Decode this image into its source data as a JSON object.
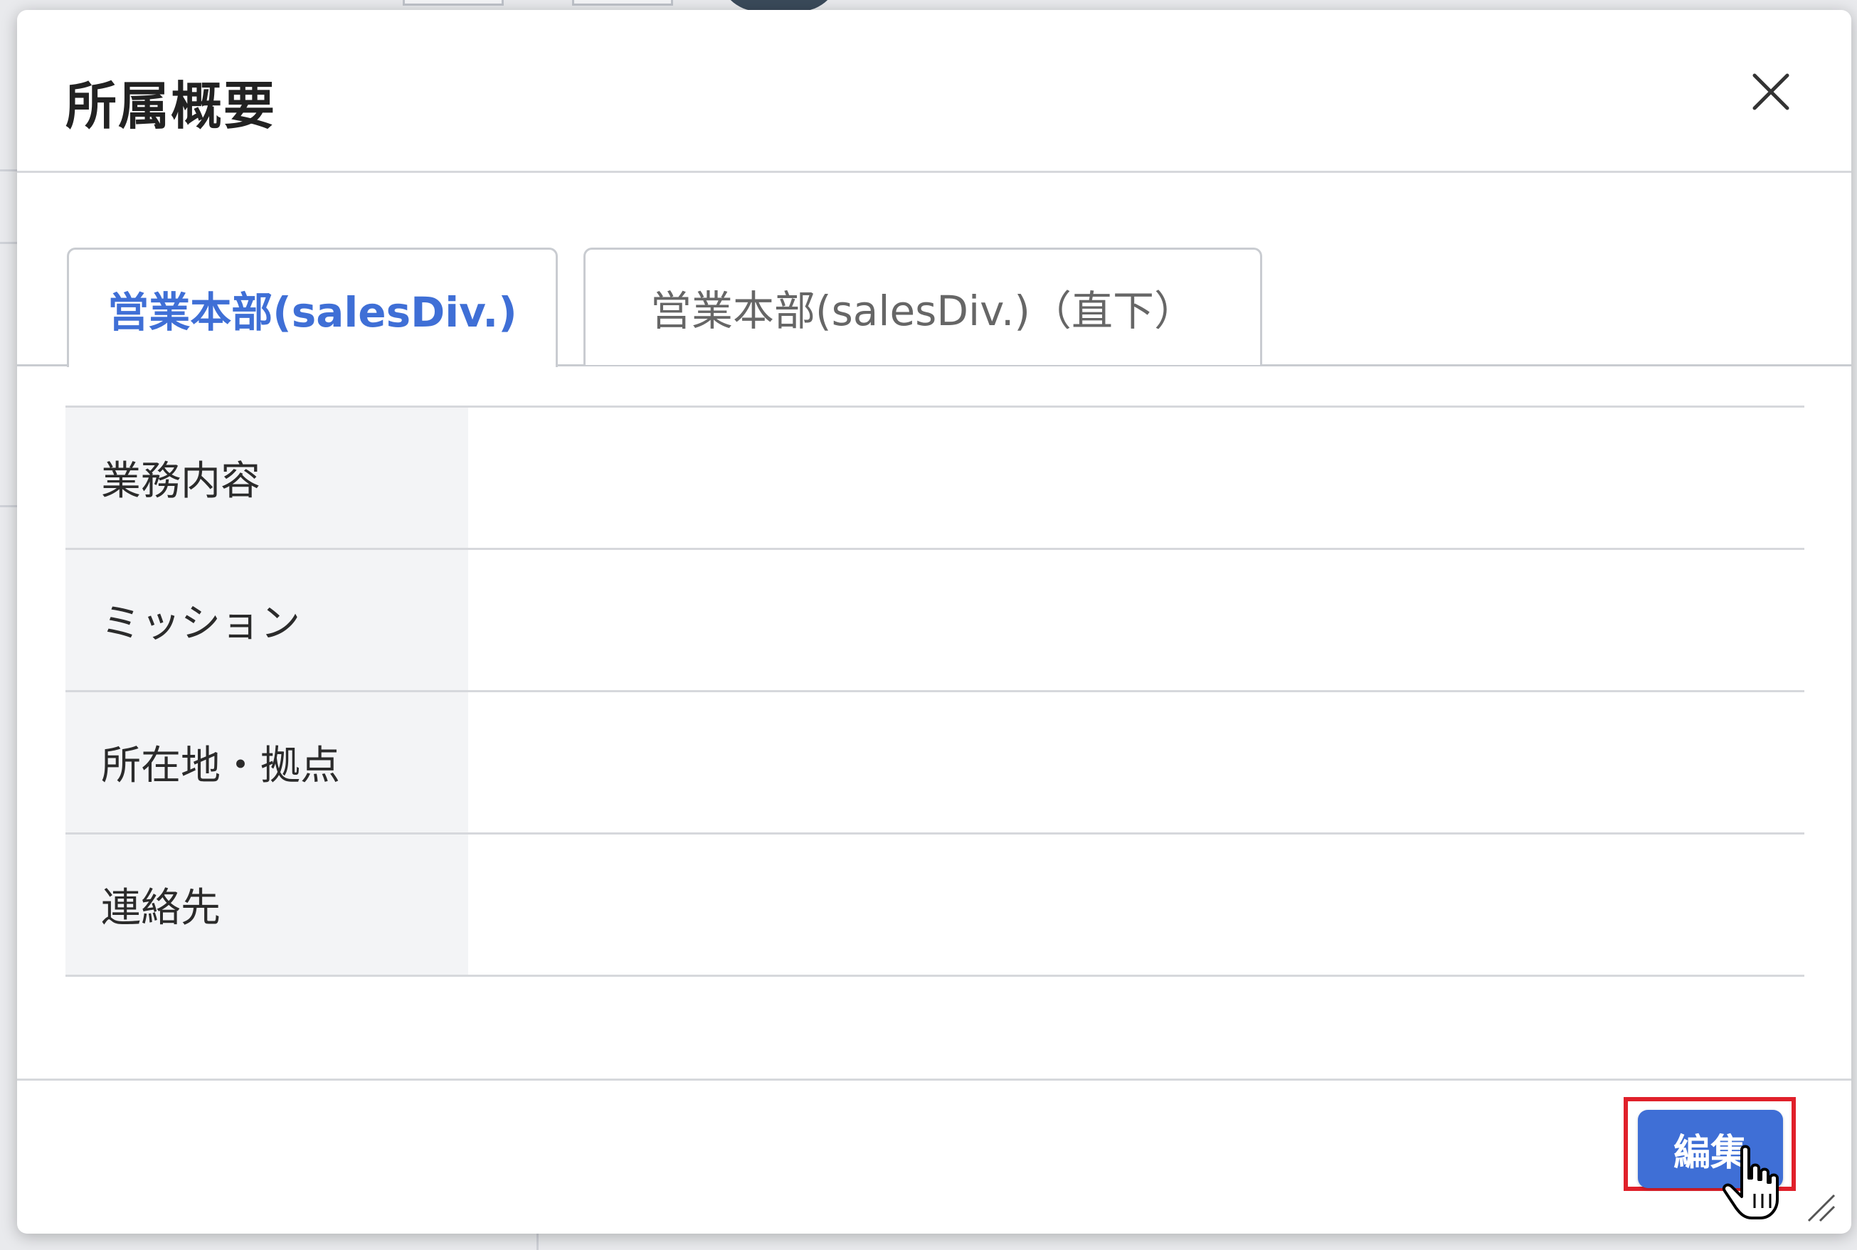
{
  "modal": {
    "title": "所属概要",
    "close_icon": "close-icon"
  },
  "tabs": [
    {
      "label": "営業本部(salesDiv.)",
      "active": true
    },
    {
      "label": "営業本部(salesDiv.)（直下）",
      "active": false
    }
  ],
  "table": {
    "rows": [
      {
        "label": "業務内容",
        "value": ""
      },
      {
        "label": "ミッション",
        "value": ""
      },
      {
        "label": "所在地・拠点",
        "value": ""
      },
      {
        "label": "連絡先",
        "value": ""
      }
    ]
  },
  "footer": {
    "edit_label": "編集"
  },
  "colors": {
    "accent": "#3f6fd6",
    "highlight": "#e0202a",
    "label_bg": "#f3f4f6"
  }
}
